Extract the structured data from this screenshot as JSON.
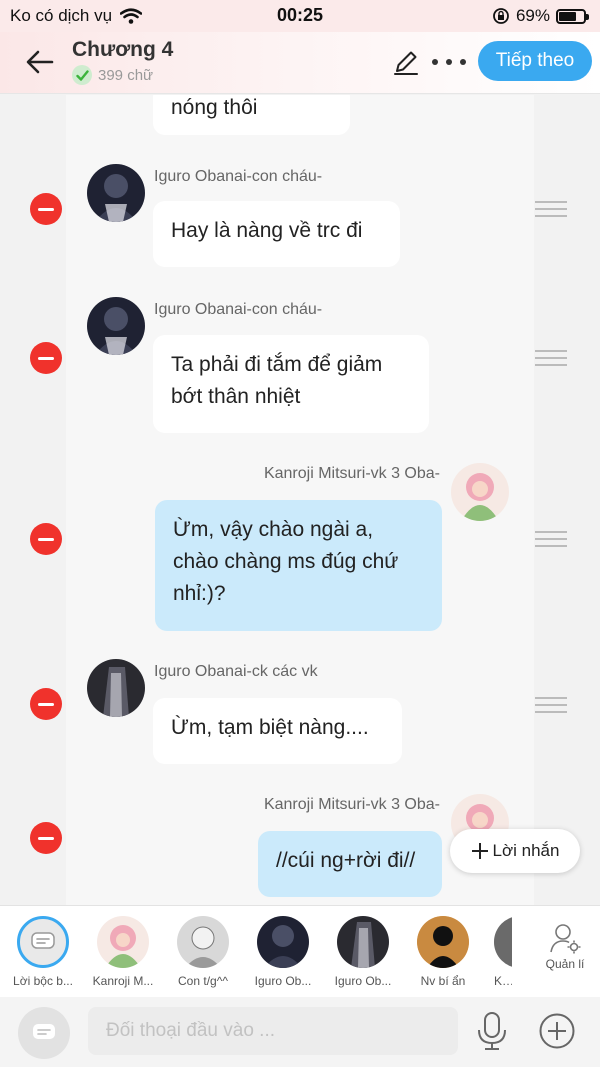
{
  "status_bar": {
    "carrier": "Ko có dịch vụ",
    "time": "00:25",
    "battery_percent": "69%",
    "battery_level": 0.69
  },
  "header": {
    "title": "Chương 4",
    "word_count": "399 chữ",
    "next_label": "Tiếp theo"
  },
  "messages": [
    {
      "speaker": "",
      "text": "nóng thôi",
      "side": "left"
    },
    {
      "speaker": "Iguro Obanai-con cháu-",
      "text": "Hay là nàng về trc đi",
      "side": "left"
    },
    {
      "speaker": "Iguro Obanai-con cháu-",
      "text": "Ta phải đi tắm để giảm bớt thân nhiệt",
      "side": "left"
    },
    {
      "speaker": "Kanroji Mitsuri-vk 3 Oba-",
      "text": "Ừm, vậy chào ngài a, chào chàng ms đúg chứ nhỉ:)?",
      "side": "right"
    },
    {
      "speaker": "Iguro Obanai-ck các vk",
      "text": "Ừm, tạm biệt nàng....",
      "side": "left"
    },
    {
      "speaker": "Kanroji Mitsuri-vk 3 Oba-",
      "text": "//cúi ng+rời đi//",
      "side": "right"
    }
  ],
  "add_note_label": "Lời nhắn",
  "characters": [
    {
      "label": "Lời bộc b...",
      "icon": "narration-icon"
    },
    {
      "label": "Kanroji M...",
      "icon": "avatar-pink"
    },
    {
      "label": "Con t/g^^",
      "icon": "avatar-sketch"
    },
    {
      "label": "Iguro Ob...",
      "icon": "avatar-dark"
    },
    {
      "label": "Iguro Ob...",
      "icon": "avatar-dark"
    },
    {
      "label": "Nv bí ẩn",
      "icon": "avatar-silhouette"
    },
    {
      "label": "Kar",
      "icon": "avatar-partial"
    }
  ],
  "manage_label": "Quản lí",
  "input": {
    "placeholder": "Đối thoại đầu vào ..."
  },
  "colors": {
    "accent": "#3aa9f0",
    "delete": "#f0322c",
    "my_bubble": "#cbeafb"
  }
}
